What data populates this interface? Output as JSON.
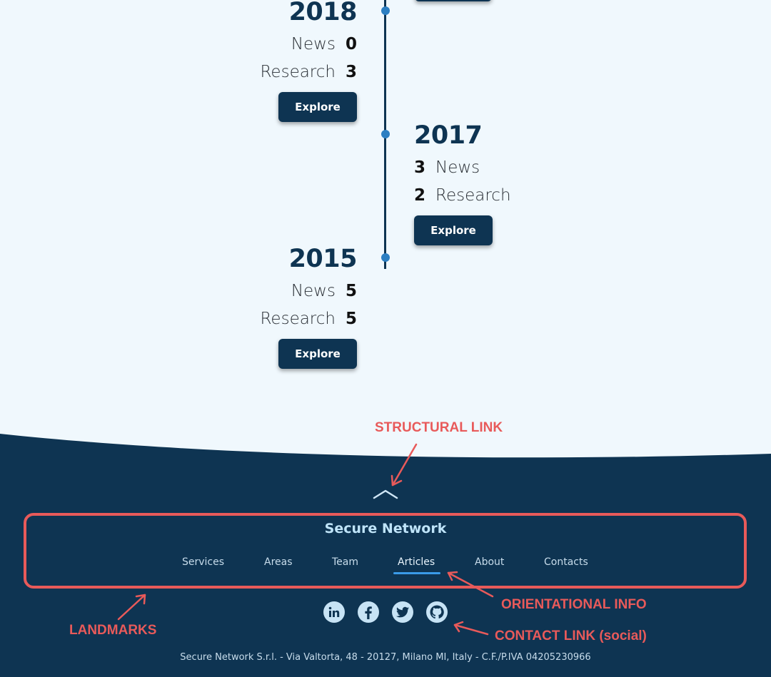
{
  "timeline": {
    "explore_label": "Explore",
    "entries": [
      {
        "year": "2018",
        "news_label": "News",
        "news_count": "0",
        "research_label": "Research",
        "research_count": "3"
      },
      {
        "year": "2017",
        "news_label": "News",
        "news_count": "3",
        "research_label": "Research",
        "research_count": "2"
      },
      {
        "year": "2015",
        "news_label": "News",
        "news_count": "5",
        "research_label": "Research",
        "research_count": "5"
      }
    ]
  },
  "footer": {
    "brand": "Secure Network",
    "nav": [
      "Services",
      "Areas",
      "Team",
      "Articles",
      "About",
      "Contacts"
    ],
    "active_nav": "Articles",
    "social_icons": [
      "linkedin-icon",
      "facebook-icon",
      "twitter-icon",
      "github-icon"
    ],
    "legal": "Secure Network S.r.l. - Via Valtorta, 48 - 20127, Milano MI, Italy - C.F./P.IVA 04205230966"
  },
  "annotations": {
    "structural_link": "STRUCTURAL LINK",
    "orientational_info": "ORIENTATIONAL INFO",
    "landmarks": "LANDMARKS",
    "contact_link": "CONTACT LINK (social)"
  },
  "colors": {
    "background": "#f0f8fd",
    "navy": "#0e3452",
    "timeline_dot": "#2c7fc2",
    "annotation": "#e85a5a",
    "active_underline": "#3a9be8"
  }
}
